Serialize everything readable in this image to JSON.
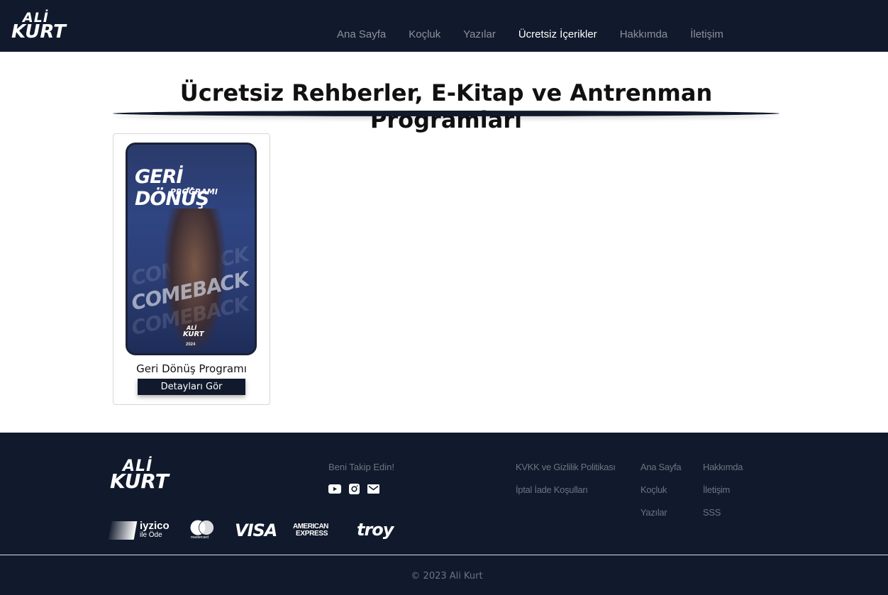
{
  "brand": {
    "line1": "ALİ",
    "line2": "KURT"
  },
  "nav": {
    "items": [
      {
        "label": "Ana Sayfa",
        "active": false
      },
      {
        "label": "Koçluk",
        "active": false
      },
      {
        "label": "Yazılar",
        "active": false
      },
      {
        "label": "Ücretsiz İçerikler",
        "active": true
      },
      {
        "label": "Hakkımda",
        "active": false
      },
      {
        "label": "İletişim",
        "active": false
      }
    ]
  },
  "main": {
    "title": "Ücretsiz Rehberler, E-Kitap ve Antrenman Programları",
    "cards": [
      {
        "cover": {
          "title": "GERİ DÖNÜŞ",
          "subtitle": "PROGRAMI",
          "background_word": "COMEBACK",
          "logo_line1": "ALİ",
          "logo_line2": "KURT",
          "year": "2024"
        },
        "title": "Geri Dönüş Programı",
        "button_label": "Detayları Gör"
      }
    ]
  },
  "footer": {
    "follow_label": "Beni Takip Edin!",
    "socials": [
      "youtube-icon",
      "instagram-icon",
      "email-icon"
    ],
    "links_col1": [
      "KVKK ve Gizlilik Politikası",
      "İptal İade Koşulları"
    ],
    "links_col2": [
      "Ana Sayfa",
      "Koçluk",
      "Yazılar"
    ],
    "links_col3": [
      "Hakkımda",
      "İletişim",
      "SSS"
    ],
    "payments": {
      "iyzico": "iyzico",
      "iyzico_sub": "ile Öde",
      "mastercard": "mastercard",
      "visa": "VISA",
      "amex_line1": "AMERICAN",
      "amex_line2": "EXPRESS",
      "troy": "troy"
    },
    "copyright": "© 2023 Ali Kurt"
  },
  "colors": {
    "navy": "#111a2c",
    "muted": "#6d7380",
    "nav_inactive": "#8c909a"
  }
}
